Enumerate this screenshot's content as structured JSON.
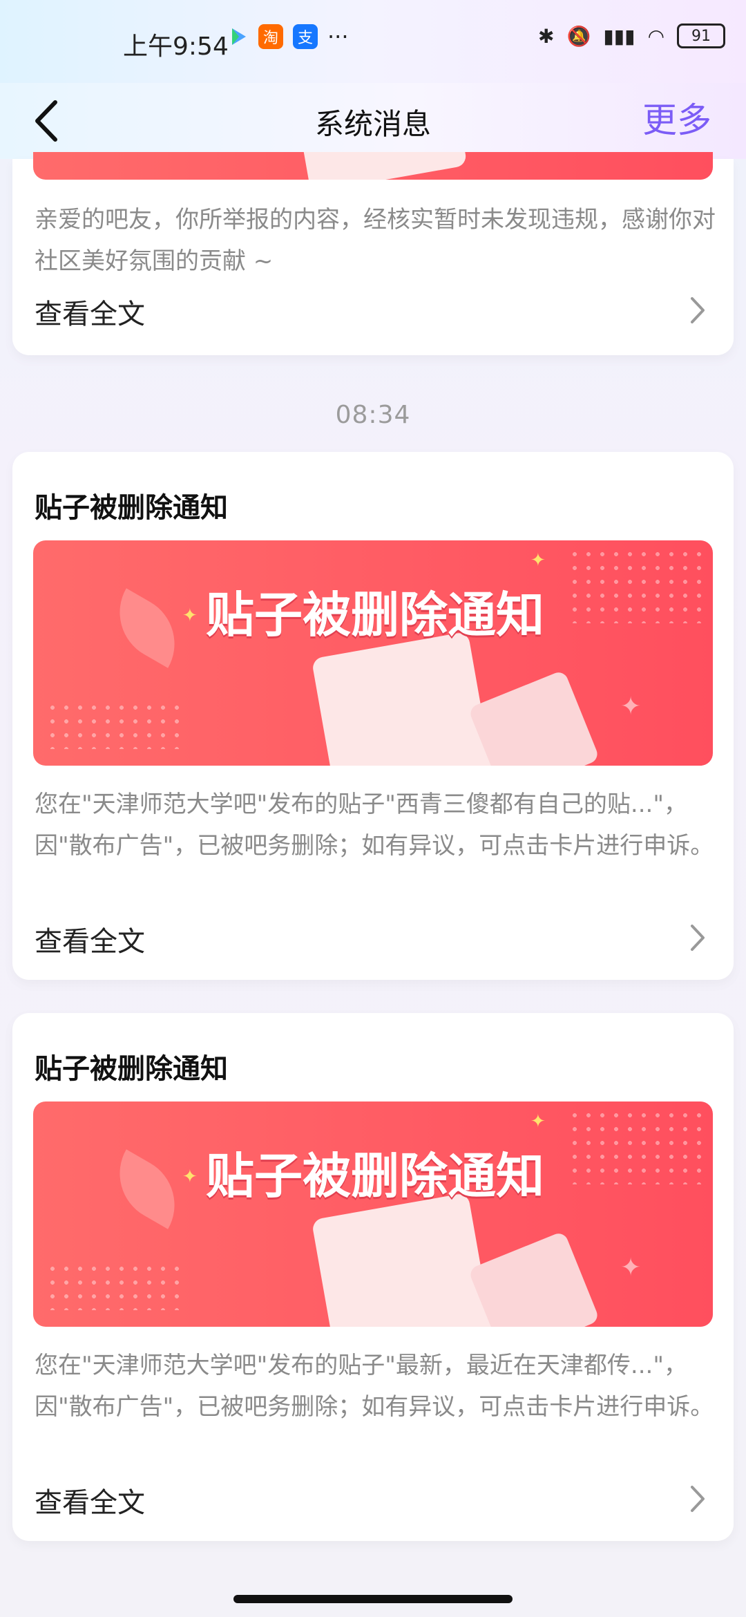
{
  "status_bar": {
    "time": "上午9:54",
    "apps": [
      "淘",
      "支"
    ],
    "overflow": "···",
    "battery": "91"
  },
  "nav": {
    "title": "系统消息",
    "more": "更多"
  },
  "messages": [
    {
      "desc": "亲爱的吧友，你所举报的内容，经核实暂时未发现违规，感谢你对社区美好氛围的贡献 ~",
      "view_full": "查看全文"
    },
    {
      "time": "08:34",
      "title": "贴子被删除通知",
      "banner_text": "贴子被删除通知",
      "desc": "您在\"天津师范大学吧\"发布的贴子\"西青三傻都有自己的贴...\"，因\"散布广告\"，已被吧务删除；如有异议，可点击卡片进行申诉。",
      "view_full": "查看全文"
    },
    {
      "title": "贴子被删除通知",
      "banner_text": "贴子被删除通知",
      "desc": "您在\"天津师范大学吧\"发布的贴子\"最新，最近在天津都传...\"，因\"散布广告\"，已被吧务删除；如有异议，可点击卡片进行申诉。",
      "view_full": "查看全文"
    }
  ],
  "colors": {
    "accent": "#7b5cf6",
    "banner": "#ff5a64"
  }
}
